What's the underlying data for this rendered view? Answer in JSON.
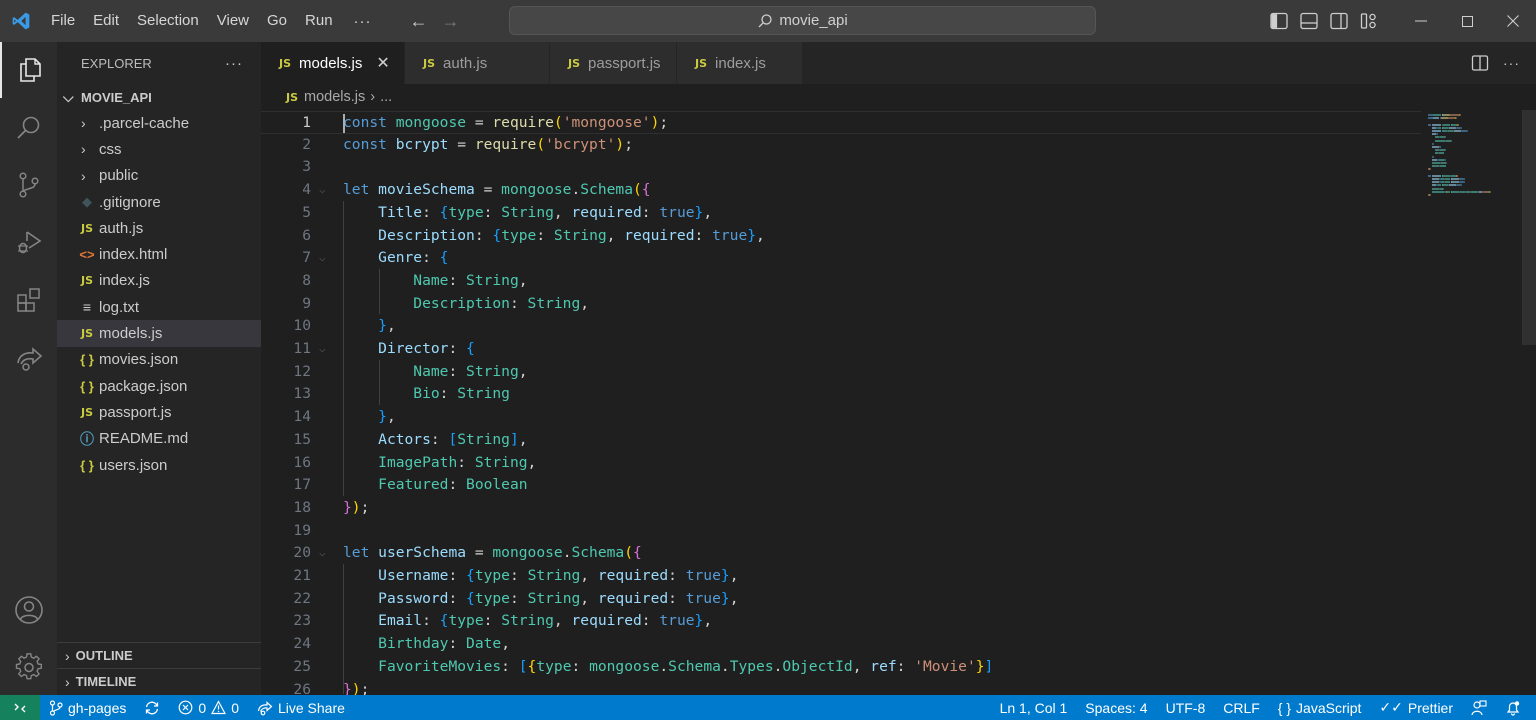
{
  "titlebar": {
    "menu": [
      "File",
      "Edit",
      "Selection",
      "View",
      "Go",
      "Run"
    ],
    "more": "···",
    "search_text": "movie_api"
  },
  "activity": [
    {
      "name": "explorer",
      "active": true
    },
    {
      "name": "search"
    },
    {
      "name": "source-control"
    },
    {
      "name": "run-debug"
    },
    {
      "name": "extensions"
    },
    {
      "name": "live-share"
    },
    {
      "name": "accounts"
    },
    {
      "name": "manage"
    }
  ],
  "sidebar": {
    "title": "EXPLORER",
    "more": "···",
    "root": "MOVIE_API",
    "items": [
      {
        "label": ".parcel-cache",
        "kind": "folder"
      },
      {
        "label": "css",
        "kind": "folder"
      },
      {
        "label": "public",
        "kind": "folder"
      },
      {
        "label": ".gitignore",
        "kind": "git"
      },
      {
        "label": "auth.js",
        "kind": "js"
      },
      {
        "label": "index.html",
        "kind": "html"
      },
      {
        "label": "index.js",
        "kind": "js"
      },
      {
        "label": "log.txt",
        "kind": "txt"
      },
      {
        "label": "models.js",
        "kind": "js",
        "selected": true
      },
      {
        "label": "movies.json",
        "kind": "json"
      },
      {
        "label": "package.json",
        "kind": "json"
      },
      {
        "label": "passport.js",
        "kind": "js"
      },
      {
        "label": "README.md",
        "kind": "info"
      },
      {
        "label": "users.json",
        "kind": "json"
      }
    ],
    "outline": "OUTLINE",
    "timeline": "TIMELINE"
  },
  "tabs": [
    {
      "label": "models.js",
      "active": true,
      "close": "✕"
    },
    {
      "label": "auth.js"
    },
    {
      "label": "passport.js"
    },
    {
      "label": "index.js"
    }
  ],
  "breadcrumb": {
    "file": "models.js",
    "sep": "›",
    "rest": "..."
  },
  "editor": {
    "current_line": 1,
    "lines": [
      [
        [
          "kw",
          "const"
        ],
        [
          "p",
          " "
        ],
        [
          "cls",
          "mongoose"
        ],
        [
          "p",
          " = "
        ],
        [
          "fn",
          "require"
        ],
        [
          "b1",
          "("
        ],
        [
          "str",
          "'mongoose'"
        ],
        [
          "b1",
          ")"
        ],
        [
          "p",
          ";"
        ]
      ],
      [
        [
          "kw",
          "const"
        ],
        [
          "p",
          " "
        ],
        [
          "var",
          "bcrypt"
        ],
        [
          "p",
          " = "
        ],
        [
          "fn",
          "require"
        ],
        [
          "b1",
          "("
        ],
        [
          "str",
          "'bcrypt'"
        ],
        [
          "b1",
          ")"
        ],
        [
          "p",
          ";"
        ]
      ],
      [],
      [
        [
          "kw",
          "let"
        ],
        [
          "p",
          " "
        ],
        [
          "var",
          "movieSchema"
        ],
        [
          "p",
          " = "
        ],
        [
          "cls",
          "mongoose"
        ],
        [
          "p",
          "."
        ],
        [
          "cls",
          "Schema"
        ],
        [
          "b1",
          "("
        ],
        [
          "b2",
          "{"
        ]
      ],
      [
        [
          "p",
          "    "
        ],
        [
          "var",
          "Title"
        ],
        [
          "p",
          ": "
        ],
        [
          "b3",
          "{"
        ],
        [
          "cls",
          "type"
        ],
        [
          "p",
          ": "
        ],
        [
          "cls",
          "String"
        ],
        [
          "p",
          ", "
        ],
        [
          "var",
          "required"
        ],
        [
          "p",
          ": "
        ],
        [
          "kw",
          "true"
        ],
        [
          "b3",
          "}"
        ],
        [
          "p",
          ","
        ]
      ],
      [
        [
          "p",
          "    "
        ],
        [
          "var",
          "Description"
        ],
        [
          "p",
          ": "
        ],
        [
          "b3",
          "{"
        ],
        [
          "cls",
          "type"
        ],
        [
          "p",
          ": "
        ],
        [
          "cls",
          "String"
        ],
        [
          "p",
          ", "
        ],
        [
          "var",
          "required"
        ],
        [
          "p",
          ": "
        ],
        [
          "kw",
          "true"
        ],
        [
          "b3",
          "}"
        ],
        [
          "p",
          ","
        ]
      ],
      [
        [
          "p",
          "    "
        ],
        [
          "var",
          "Genre"
        ],
        [
          "p",
          ": "
        ],
        [
          "b3",
          "{"
        ]
      ],
      [
        [
          "p",
          "        "
        ],
        [
          "cls",
          "Name"
        ],
        [
          "p",
          ": "
        ],
        [
          "cls",
          "String"
        ],
        [
          "p",
          ","
        ]
      ],
      [
        [
          "p",
          "        "
        ],
        [
          "cls",
          "Description"
        ],
        [
          "p",
          ": "
        ],
        [
          "cls",
          "String"
        ],
        [
          "p",
          ","
        ]
      ],
      [
        [
          "p",
          "    "
        ],
        [
          "b3",
          "}"
        ],
        [
          "p",
          ","
        ]
      ],
      [
        [
          "p",
          "    "
        ],
        [
          "var",
          "Director"
        ],
        [
          "p",
          ": "
        ],
        [
          "b3",
          "{"
        ]
      ],
      [
        [
          "p",
          "        "
        ],
        [
          "cls",
          "Name"
        ],
        [
          "p",
          ": "
        ],
        [
          "cls",
          "String"
        ],
        [
          "p",
          ","
        ]
      ],
      [
        [
          "p",
          "        "
        ],
        [
          "cls",
          "Bio"
        ],
        [
          "p",
          ": "
        ],
        [
          "cls",
          "String"
        ]
      ],
      [
        [
          "p",
          "    "
        ],
        [
          "b3",
          "}"
        ],
        [
          "p",
          ","
        ]
      ],
      [
        [
          "p",
          "    "
        ],
        [
          "var",
          "Actors"
        ],
        [
          "p",
          ": "
        ],
        [
          "b3",
          "["
        ],
        [
          "cls",
          "String"
        ],
        [
          "b3",
          "]"
        ],
        [
          "p",
          ","
        ]
      ],
      [
        [
          "p",
          "    "
        ],
        [
          "cls",
          "ImagePath"
        ],
        [
          "p",
          ": "
        ],
        [
          "cls",
          "String"
        ],
        [
          "p",
          ","
        ]
      ],
      [
        [
          "p",
          "    "
        ],
        [
          "cls",
          "Featured"
        ],
        [
          "p",
          ": "
        ],
        [
          "cls",
          "Boolean"
        ]
      ],
      [
        [
          "b2",
          "}"
        ],
        [
          "b1",
          ")"
        ],
        [
          "p",
          ";"
        ]
      ],
      [],
      [
        [
          "kw",
          "let"
        ],
        [
          "p",
          " "
        ],
        [
          "var",
          "userSchema"
        ],
        [
          "p",
          " = "
        ],
        [
          "cls",
          "mongoose"
        ],
        [
          "p",
          "."
        ],
        [
          "cls",
          "Schema"
        ],
        [
          "b1",
          "("
        ],
        [
          "b2",
          "{"
        ]
      ],
      [
        [
          "p",
          "    "
        ],
        [
          "var",
          "Username"
        ],
        [
          "p",
          ": "
        ],
        [
          "b3",
          "{"
        ],
        [
          "cls",
          "type"
        ],
        [
          "p",
          ": "
        ],
        [
          "cls",
          "String"
        ],
        [
          "p",
          ", "
        ],
        [
          "var",
          "required"
        ],
        [
          "p",
          ": "
        ],
        [
          "kw",
          "true"
        ],
        [
          "b3",
          "}"
        ],
        [
          "p",
          ","
        ]
      ],
      [
        [
          "p",
          "    "
        ],
        [
          "var",
          "Password"
        ],
        [
          "p",
          ": "
        ],
        [
          "b3",
          "{"
        ],
        [
          "cls",
          "type"
        ],
        [
          "p",
          ": "
        ],
        [
          "cls",
          "String"
        ],
        [
          "p",
          ", "
        ],
        [
          "var",
          "required"
        ],
        [
          "p",
          ": "
        ],
        [
          "kw",
          "true"
        ],
        [
          "b3",
          "}"
        ],
        [
          "p",
          ","
        ]
      ],
      [
        [
          "p",
          "    "
        ],
        [
          "var",
          "Email"
        ],
        [
          "p",
          ": "
        ],
        [
          "b3",
          "{"
        ],
        [
          "cls",
          "type"
        ],
        [
          "p",
          ": "
        ],
        [
          "cls",
          "String"
        ],
        [
          "p",
          ", "
        ],
        [
          "var",
          "required"
        ],
        [
          "p",
          ": "
        ],
        [
          "kw",
          "true"
        ],
        [
          "b3",
          "}"
        ],
        [
          "p",
          ","
        ]
      ],
      [
        [
          "p",
          "    "
        ],
        [
          "cls",
          "Birthday"
        ],
        [
          "p",
          ": "
        ],
        [
          "cls",
          "Date"
        ],
        [
          "p",
          ","
        ]
      ],
      [
        [
          "p",
          "    "
        ],
        [
          "cls",
          "FavoriteMovies"
        ],
        [
          "p",
          ": "
        ],
        [
          "b3",
          "["
        ],
        [
          "b1",
          "{"
        ],
        [
          "cls",
          "type"
        ],
        [
          "p",
          ": "
        ],
        [
          "cls",
          "mongoose"
        ],
        [
          "p",
          "."
        ],
        [
          "cls",
          "Schema"
        ],
        [
          "p",
          "."
        ],
        [
          "cls",
          "Types"
        ],
        [
          "p",
          "."
        ],
        [
          "cls",
          "ObjectId"
        ],
        [
          "p",
          ", "
        ],
        [
          "var",
          "ref"
        ],
        [
          "p",
          ": "
        ],
        [
          "str",
          "'Movie'"
        ],
        [
          "b1",
          "}"
        ],
        [
          "b3",
          "]"
        ]
      ],
      [
        [
          "b2",
          "}"
        ],
        [
          "b1",
          ")"
        ],
        [
          "p",
          ";"
        ]
      ]
    ],
    "foldable_lines": [
      4,
      7,
      11,
      20
    ]
  },
  "statusbar": {
    "branch": "gh-pages",
    "errors": "0",
    "warnings": "0",
    "live_share": "Live Share",
    "position": "Ln 1, Col 1",
    "spaces": "Spaces: 4",
    "encoding": "UTF-8",
    "eol": "CRLF",
    "language": "JavaScript",
    "formatter": "Prettier"
  }
}
